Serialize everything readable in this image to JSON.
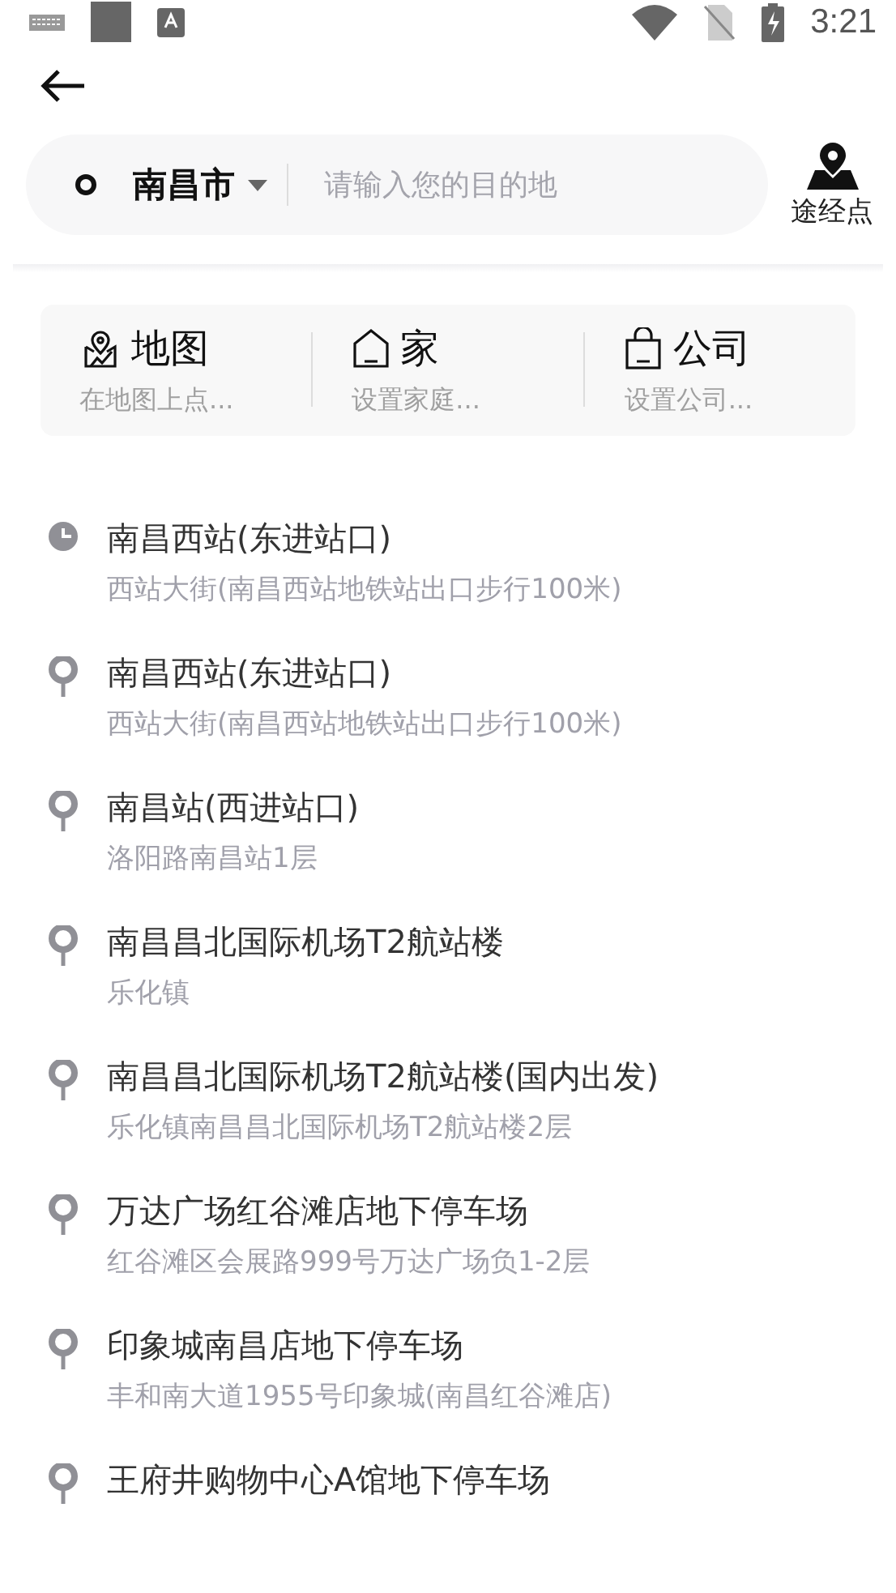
{
  "status_bar": {
    "time": "3:21"
  },
  "search": {
    "city": "南昌市",
    "placeholder": "请输入您的目的地",
    "waypoint_label": "途经点"
  },
  "shortcuts": [
    {
      "kind": "map",
      "title": "地图",
      "subtitle": "在地图上点..."
    },
    {
      "kind": "home",
      "title": "家",
      "subtitle": "设置家庭..."
    },
    {
      "kind": "company",
      "title": "公司",
      "subtitle": "设置公司..."
    }
  ],
  "places": [
    {
      "kind": "history",
      "name": "南昌西站(东进站口)",
      "address": "西站大街(南昌西站地铁站出口步行100米)"
    },
    {
      "kind": "place",
      "name": "南昌西站(东进站口)",
      "address": "西站大街(南昌西站地铁站出口步行100米)"
    },
    {
      "kind": "place",
      "name": "南昌站(西进站口)",
      "address": "洛阳路南昌站1层"
    },
    {
      "kind": "place",
      "name": "南昌昌北国际机场T2航站楼",
      "address": "乐化镇"
    },
    {
      "kind": "place",
      "name": "南昌昌北国际机场T2航站楼(国内出发)",
      "address": "乐化镇南昌昌北国际机场T2航站楼2层"
    },
    {
      "kind": "place",
      "name": "万达广场红谷滩店地下停车场",
      "address": "红谷滩区会展路999号万达广场负1-2层"
    },
    {
      "kind": "place",
      "name": "印象城南昌店地下停车场",
      "address": "丰和南大道1955号印象城(南昌红谷滩店)"
    },
    {
      "kind": "place",
      "name": "王府井购物中心A馆地下停车场"
    }
  ]
}
